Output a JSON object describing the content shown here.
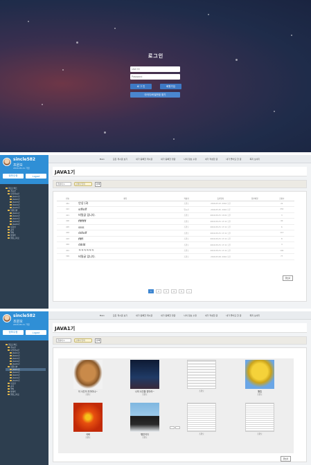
{
  "login": {
    "title": "로그인",
    "id_placeholder": "User ID",
    "pw_placeholder": "Password",
    "login_button": "로 그 인",
    "register_button": "회원가입",
    "find_button": "아이디/비밀번호 찾기"
  },
  "sidebar": {
    "username": "sincle582",
    "display_name": "조원오",
    "date": "2016.05.21 가입",
    "profile_button": "정보수정",
    "logout_button": "Logout",
    "tree": [
      {
        "label": "웹프로젝트",
        "level": 1
      },
      {
        "label": "게시판",
        "level": 2
      },
      {
        "label": "자유게시판",
        "level": 2
      },
      {
        "label": "JAVA1기",
        "level": 3
      },
      {
        "label": "JAVA2기",
        "level": 3
      },
      {
        "label": "JAVA3기",
        "level": 3
      },
      {
        "label": "JAVA4기",
        "level": 3
      },
      {
        "label": "JAVA5기",
        "level": 3
      },
      {
        "label": "질문답변",
        "level": 2
      },
      {
        "label": "JAVA1기",
        "level": 3
      },
      {
        "label": "JAVA2기",
        "level": 3
      },
      {
        "label": "JAVA3기",
        "level": 3
      },
      {
        "label": "JAVA4기",
        "level": 3
      },
      {
        "label": "JAVA5기",
        "level": 3
      },
      {
        "label": "자료실",
        "level": 2
      },
      {
        "label": "공지",
        "level": 2
      },
      {
        "label": "앨범",
        "level": 2
      },
      {
        "label": "방명록",
        "level": 2
      },
      {
        "label": "웹참고자료",
        "level": 2
      }
    ]
  },
  "topnav": [
    "Main",
    "모든 게시글 보기",
    "내가 등록한 게시글",
    "내가 등록한 댓글",
    "나의 정보 수정",
    "내가 작성한 글",
    "내가 좋아요 한 글",
    "쪽지 보내기"
  ],
  "board": {
    "title": "JAVA1기",
    "select_value": "글쓴이 ▾",
    "search_placeholder": "검색어 입력",
    "search_button": "검색",
    "write_button": "글쓰기",
    "columns": [
      "번호",
      "제목",
      "작성자",
      "등록일자",
      "첨부파일",
      "조회수"
    ],
    "rows": [
      {
        "no": "461",
        "title": "안녕 (3)",
        "author": "조원오",
        "date": "2016.05.23. 2016 오전",
        "file": "",
        "hits": "22"
      },
      {
        "no": "422",
        "title": "sdfsdf",
        "author": "임시선",
        "date": "2016.05.25. 2016 오후",
        "file": "",
        "hits": "355"
      },
      {
        "no": "421",
        "title": "비밀글 입니다.",
        "author": "조원오",
        "date": "2016.05.23. 13:01 오후",
        "file": "",
        "hits": "3"
      },
      {
        "no": "406",
        "title": "ffffffff",
        "author": "조원오",
        "date": "2016.05.23. 17:11 오후",
        "file": "",
        "hits": "90"
      },
      {
        "no": "405",
        "title": "ssss",
        "author": "조원오",
        "date": "2016.05.23. 17:11 오후",
        "file": "",
        "hits": "6"
      },
      {
        "no": "404",
        "title": "dsfsdf",
        "author": "조원오",
        "date": "2016.05.23. 17:11 오후",
        "file": "",
        "hits": "113"
      },
      {
        "no": "403",
        "title": "fffff",
        "author": "조원오",
        "date": "2016.05.23. 17:11 오후",
        "file": "",
        "hits": "8"
      },
      {
        "no": "402",
        "title": "dddd",
        "author": "조원오",
        "date": "2016.05.23. 17:11 오후",
        "file": "",
        "hits": "4"
      },
      {
        "no": "401",
        "title": "ㅋㅋㅋㅋㅋㅋ",
        "author": "조원오",
        "date": "2016.05.23. 17:11 오후",
        "file": "",
        "hits": "100"
      },
      {
        "no": "399",
        "title": "비밀글 입니다.",
        "author": "조원오",
        "date": "2016.05.09. 2016 오전",
        "file": "",
        "hits": "77"
      }
    ],
    "pages": [
      "1",
      "2",
      "3",
      "4",
      "5",
      "»"
    ]
  },
  "gallery": {
    "title": "JAVA1기",
    "select_value": "글쓴이 ▾",
    "search_placeholder": "검색어 입력",
    "search_button": "검색",
    "write_button": "글쓰기",
    "items": [
      {
        "caption": "이 사진이 무엇이냐~",
        "author": "조원오"
      },
      {
        "caption": "나의 사진을 받아라~",
        "author": "조원오"
      },
      {
        "caption": "",
        "author": "조원오"
      },
      {
        "caption": "튤립",
        "author": "조원오"
      },
      {
        "caption": "국화",
        "author": "조원오"
      },
      {
        "caption": "펭귄이다",
        "author": "조원오"
      },
      {
        "caption": "",
        "author": "조원오"
      },
      {
        "caption": "",
        "author": "조원오"
      }
    ]
  },
  "colors": {
    "accent": "#2f8fd6",
    "sidebar_bg": "#2d3e4f",
    "button_blue": "#3e79c4"
  }
}
